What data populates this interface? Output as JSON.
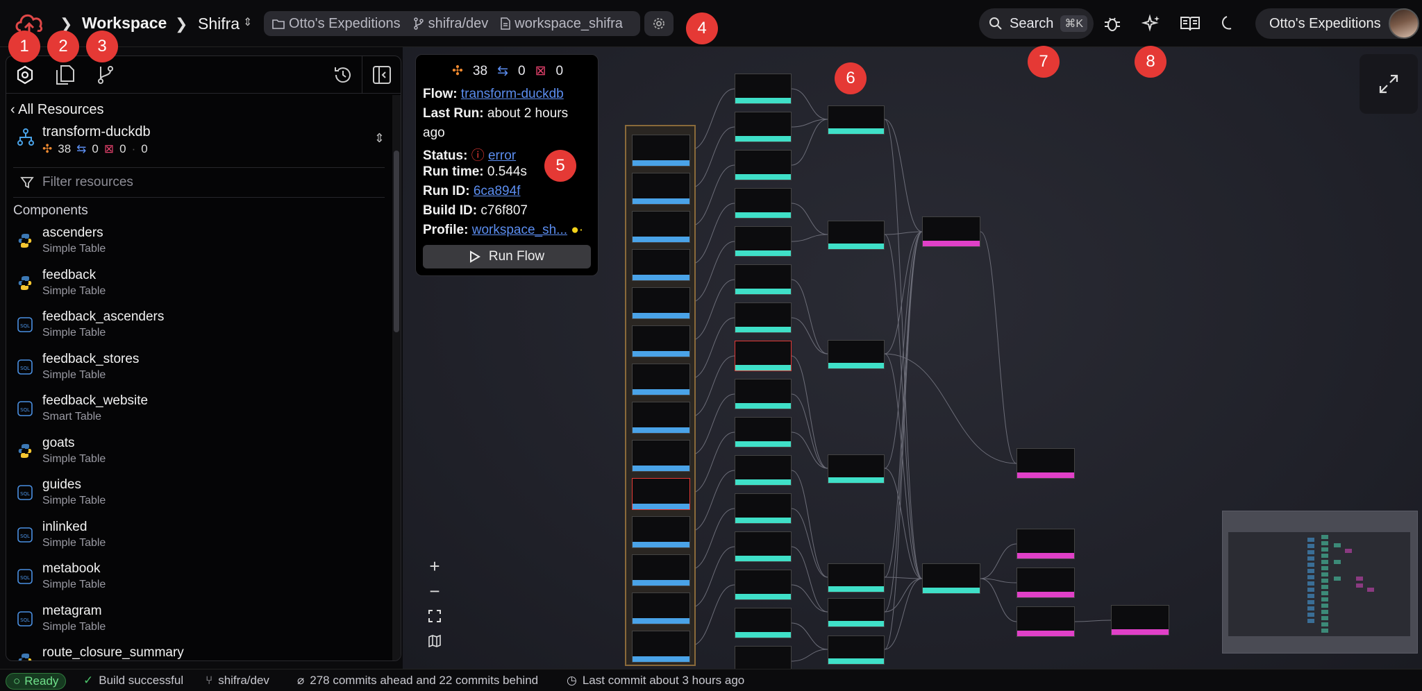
{
  "header": {
    "crumb_workspace": "Workspace",
    "crumb_project": "Shifra",
    "org_pill": "Otto's Expeditions",
    "branch_pill": "shifra/dev",
    "file_pill": "workspace_shifra",
    "search_label": "Search",
    "search_kbd": "⌘K",
    "account_name": "Otto's Expeditions"
  },
  "markers": [
    "1",
    "2",
    "3",
    "4",
    "5",
    "6",
    "7",
    "8"
  ],
  "sidebar": {
    "back_label": "All Resources",
    "flow_name": "transform-duckdb",
    "stat_components": "38",
    "stat_tests": "0",
    "stat_errors": "0",
    "stat_other": "0",
    "filter_placeholder": "Filter resources",
    "section_title": "Components",
    "items": [
      {
        "name": "ascenders",
        "type": "Simple Table",
        "icon": "python-icon"
      },
      {
        "name": "feedback",
        "type": "Simple Table",
        "icon": "python-icon"
      },
      {
        "name": "feedback_ascenders",
        "type": "Simple Table",
        "icon": "sql-icon"
      },
      {
        "name": "feedback_stores",
        "type": "Simple Table",
        "icon": "sql-icon"
      },
      {
        "name": "feedback_website",
        "type": "Smart Table",
        "icon": "sql-icon"
      },
      {
        "name": "goats",
        "type": "Simple Table",
        "icon": "python-icon"
      },
      {
        "name": "guides",
        "type": "Simple Table",
        "icon": "sql-icon"
      },
      {
        "name": "inlinked",
        "type": "Simple Table",
        "icon": "sql-icon"
      },
      {
        "name": "metabook",
        "type": "Simple Table",
        "icon": "sql-icon"
      },
      {
        "name": "metagram",
        "type": "Simple Table",
        "icon": "sql-icon"
      },
      {
        "name": "route_closure_summary",
        "type": "",
        "icon": "python-icon"
      }
    ]
  },
  "info_card": {
    "stat_components": "38",
    "stat_tests": "0",
    "stat_errors": "0",
    "flow_label": "Flow:",
    "flow_value": "transform-duckdb",
    "last_run_label": "Last Run:",
    "last_run_value_line1": "about 2 hours",
    "last_run_value_line2": "ago",
    "status_label": "Status:",
    "status_value": "error",
    "run_time_label": "Run time:",
    "run_time_value": "0.544s",
    "run_id_label": "Run ID:",
    "run_id_value": "6ca894f",
    "build_id_label": "Build ID:",
    "build_id_value": "c76f807",
    "profile_label": "Profile:",
    "profile_value": "workspace_sh...",
    "run_button": "Run Flow"
  },
  "statusbar": {
    "ready": "Ready",
    "build": "Build successful",
    "branch": "shifra/dev",
    "commits": "278 commits ahead and 22 commits behind",
    "last_commit": "Last commit about 3 hours ago"
  },
  "colors": {
    "accent_blue": "#5b8def",
    "marker_red": "#e53935",
    "node_teal": "#3fe0c8",
    "node_blue": "#4aa3e8",
    "node_pink": "#e040c8",
    "error_red": "#e53935"
  }
}
